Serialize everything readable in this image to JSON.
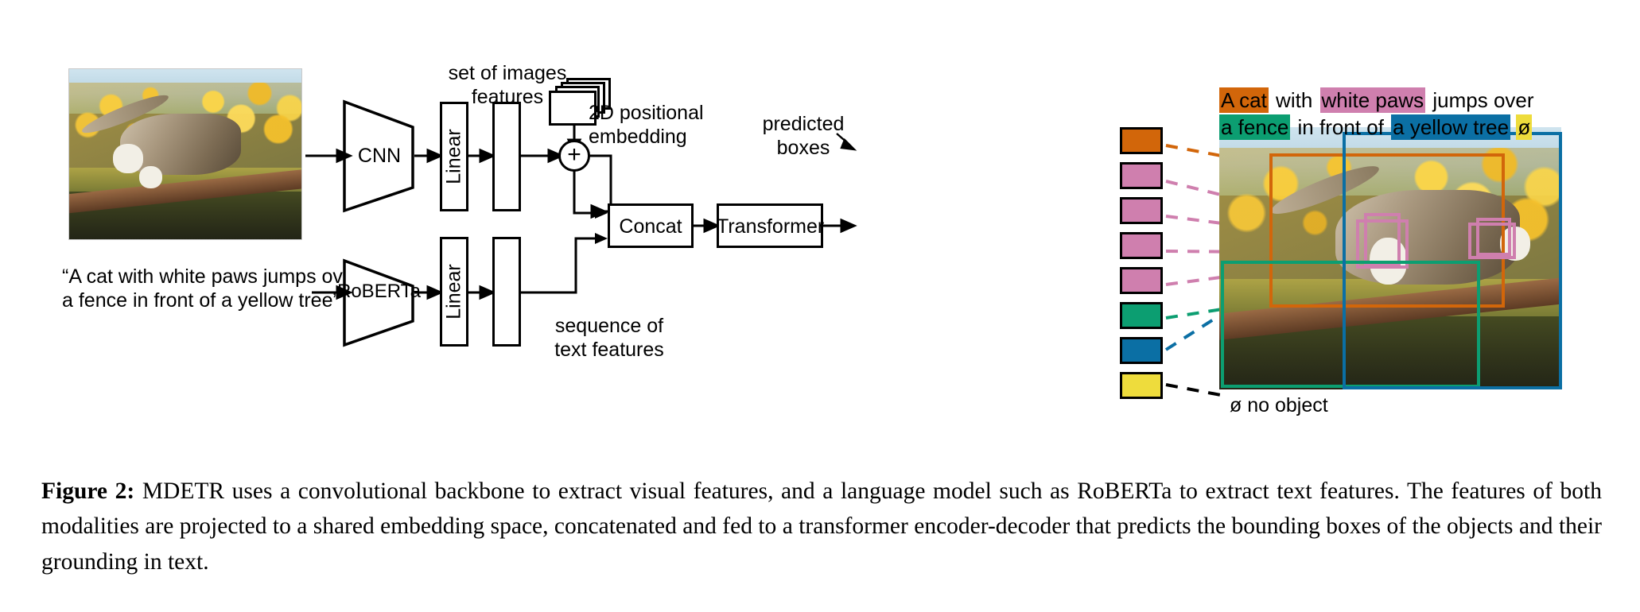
{
  "figure": {
    "number": "Figure 2:",
    "caption": "MDETR uses a convolutional backbone to extract visual features, and a language model such as RoBERTa to extract text features. The features of both modalities are projected to a shared embedding space, concatenated and fed to a transformer encoder-decoder that predicts the bounding boxes of the objects and their grounding in text."
  },
  "diagram": {
    "input_image_alt": "photo of a tabby cat with white paws jumping over a mossy wooden fence in front of a yellow birch tree",
    "input_text": "“A cat with white paws jumps over\na fence in front of a yellow tree”",
    "cnn_label": "CNN",
    "roberta_label": "RoBERTa",
    "linear_image_label": "Linear",
    "linear_text_label": "Linear",
    "set_of_image_features_label": "set of images\nfeatures",
    "positional_embedding_label": "2D positional\nembedding",
    "sequence_of_text_features_label": "sequence of\ntext features",
    "sum_symbol": "+",
    "concat_label": "Concat",
    "transformer_label": "Transformer",
    "predicted_boxes_label": "predicted\nboxes",
    "no_object_label": "ø no object"
  },
  "grounded_caption": {
    "line1": [
      {
        "text": "A cat",
        "color": "#d2660a",
        "text_color": "#000000"
      },
      {
        "text": " with ",
        "color": "transparent",
        "text_color": "#000000"
      },
      {
        "text": "white paws",
        "color": "#cf7fae",
        "text_color": "#000000"
      },
      {
        "text": " jumps over",
        "color": "transparent",
        "text_color": "#000000"
      }
    ],
    "line2": [
      {
        "text": "a fence",
        "color": "#0c9e71",
        "text_color": "#000000"
      },
      {
        "text": " in front of ",
        "color": "transparent",
        "text_color": "#000000"
      },
      {
        "text": "a yellow tree",
        "color": "#0b6fa4",
        "text_color": "#000000"
      },
      {
        "text": " ",
        "color": "transparent",
        "text_color": "#000000"
      },
      {
        "text": "ø",
        "color": "#eedc3c",
        "text_color": "#000000"
      }
    ]
  },
  "predicted_boxes": [
    {
      "index": 0,
      "color": "#d2660a",
      "meaning": "A cat"
    },
    {
      "index": 1,
      "color": "#cf7fae",
      "meaning": "white paws"
    },
    {
      "index": 2,
      "color": "#cf7fae",
      "meaning": "white paws"
    },
    {
      "index": 3,
      "color": "#cf7fae",
      "meaning": "white paws"
    },
    {
      "index": 4,
      "color": "#cf7fae",
      "meaning": "white paws"
    },
    {
      "index": 5,
      "color": "#0c9e71",
      "meaning": "a fence"
    },
    {
      "index": 6,
      "color": "#0b6fa4",
      "meaning": "a yellow tree"
    },
    {
      "index": 7,
      "color": "#eedc3c",
      "meaning": "no object"
    }
  ],
  "colors": {
    "orange": "#d2660a",
    "pink": "#cf7fae",
    "green": "#0c9e71",
    "blue": "#0b6fa4",
    "yellow": "#eedc3c",
    "outline": "#000000",
    "page_bg": "#ffffff"
  }
}
